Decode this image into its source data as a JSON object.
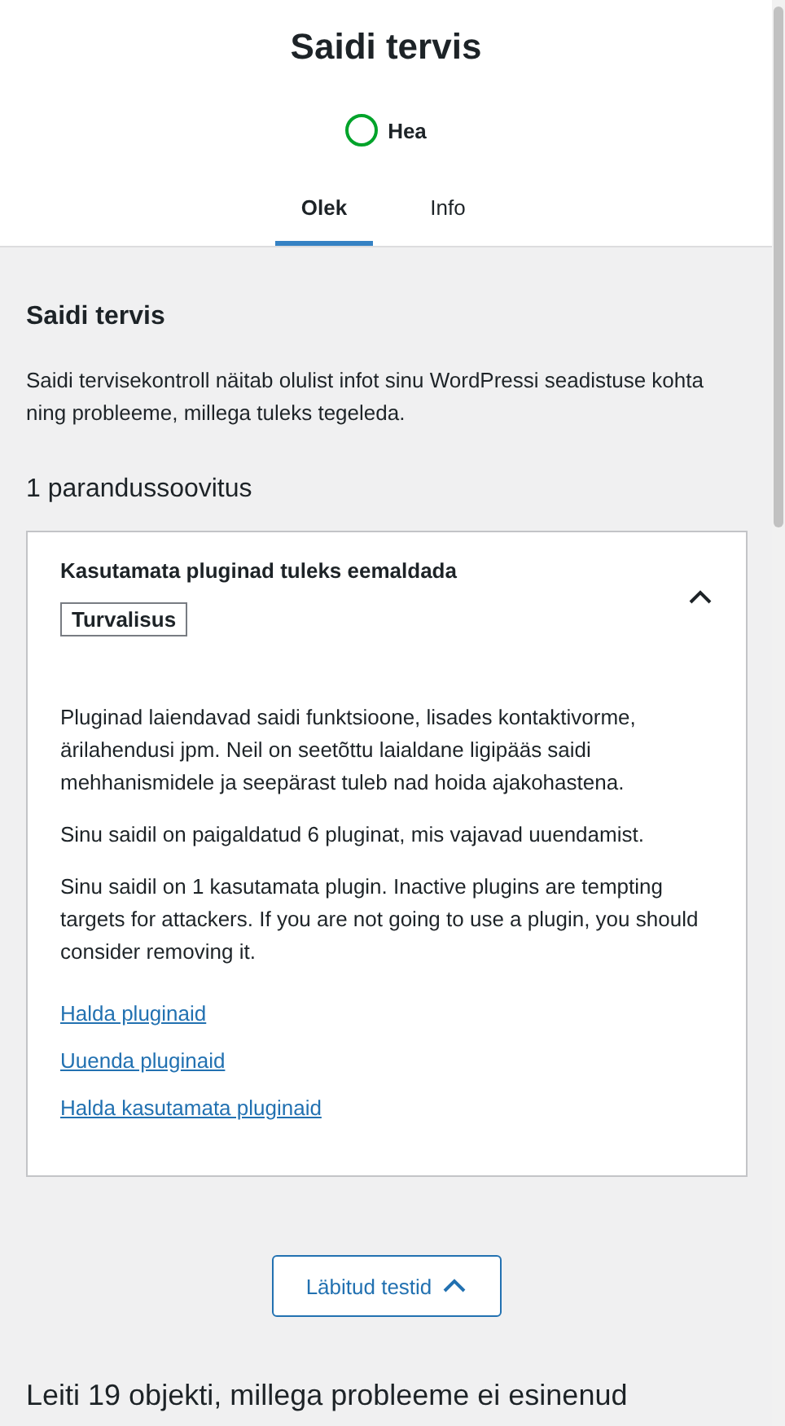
{
  "header": {
    "title": "Saidi tervis",
    "status": {
      "label": "Hea",
      "kind": "good"
    }
  },
  "tabs": [
    {
      "label": "Olek",
      "selected": true
    },
    {
      "label": "Info",
      "selected": false
    }
  ],
  "section": {
    "title": "Saidi tervis",
    "description": "Saidi tervisekontroll näitab olulist infot sinu WordPressi seadistuse kohta ning probleeme, millega tuleks tegeleda."
  },
  "issues_heading": "1 parandussoovitus",
  "issues": [
    {
      "title": "Kasutamata pluginad tuleks eemaldada",
      "tag": "Turvalisus",
      "expanded": true,
      "paragraphs": [
        "Pluginad laiendavad saidi funktsioone, lisades kontaktivorme, ärilahendusi jpm. Neil on seetõttu laialdane ligipääs saidi mehhanismidele ja seepärast tuleb nad hoida ajakohastena.",
        "Sinu saidil on paigaldatud 6 pluginat, mis vajavad uuendamist.",
        "Sinu saidil on 1 kasutamata plugin. Inactive plugins are tempting targets for attackers. If you are not going to use a plugin, you should consider removing it."
      ],
      "links": [
        "Halda pluginaid",
        "Uuenda pluginaid",
        "Halda kasutamata pluginaid"
      ]
    }
  ],
  "passed_button": {
    "label": "Läbitud testid",
    "expanded": true
  },
  "passed_heading": "Leiti 19 objekti, millega probleeme ei esinenud"
}
